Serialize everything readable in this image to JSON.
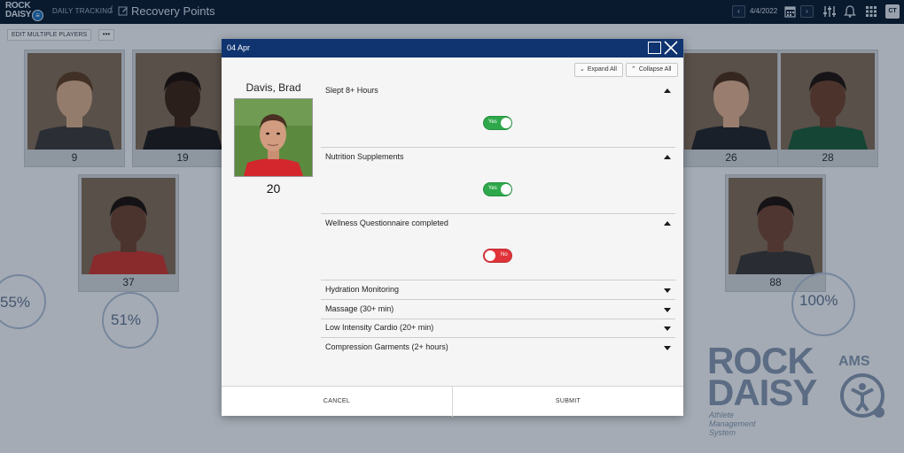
{
  "topbar": {
    "logo_line1": "ROCK",
    "logo_line2": "DAISY",
    "logo_badge": "≡",
    "breadcrumb": "DAILY TRACKING",
    "breadcrumb_sep": "/",
    "page_title": "Recovery Points",
    "date": "4/4/2022",
    "prev_label": "‹",
    "next_label": "›",
    "user_initials": "CT",
    "icons": [
      "calendar-icon",
      "sliders-icon",
      "bell-icon",
      "apps-grid-icon"
    ]
  },
  "page": {
    "edit_multiple_label": "EDIT MULTIPLE PLAYERS",
    "more_label": "•••",
    "players": [
      {
        "number": "9",
        "skin": "#d2a98a",
        "hair": "#5a3d25",
        "jersey": "#3b3b3b"
      },
      {
        "number": "19",
        "skin": "#3b2418",
        "hair": "#1c110b",
        "jersey": "#1d1d1d"
      },
      {
        "number": "26",
        "skin": "#d9ad8e",
        "hair": "#4a2f1d",
        "jersey": "#23262b"
      },
      {
        "number": "28",
        "skin": "#6b4330",
        "hair": "#1f1511",
        "jersey": "#1c5b3a"
      },
      {
        "number": "37",
        "skin": "#6a4331",
        "hair": "#1a120d",
        "jersey": "#c23530"
      },
      {
        "number": "88",
        "skin": "#6f4634",
        "hair": "#1c130e",
        "jersey": "#383838"
      }
    ],
    "stats": [
      "55%",
      "51%",
      "100%"
    ],
    "brand_line1": "ROCK",
    "brand_line2": "DAISY",
    "brand_ams": "AMS",
    "brand_tagline": "Athlete Management System"
  },
  "modal": {
    "title": "04 Apr",
    "expand_all": "Expand All",
    "collapse_all": "Collapse All",
    "player_name": "Davis, Brad",
    "player_number": "20",
    "sections": [
      {
        "label": "Slept 8+ Hours",
        "expanded": true,
        "toggle": "Yes",
        "on": true
      },
      {
        "label": "Nutrition Supplements",
        "expanded": true,
        "toggle": "Yes",
        "on": true
      },
      {
        "label": "Wellness Questionnaire completed",
        "expanded": true,
        "toggle": "No",
        "on": false
      },
      {
        "label": "Hydration Monitoring",
        "expanded": false
      },
      {
        "label": "Massage (30+ min)",
        "expanded": false
      },
      {
        "label": "Low Intensity Cardio (20+ min)",
        "expanded": false
      },
      {
        "label": "Compression Garments (2+ hours)",
        "expanded": false
      }
    ],
    "cancel_label": "CANCEL",
    "submit_label": "SUBMIT"
  },
  "colors": {
    "header_navy": "#0b1d33",
    "modal_header": "#0f3470",
    "toggle_on": "#2ea84a",
    "toggle_off": "#e0343a"
  }
}
